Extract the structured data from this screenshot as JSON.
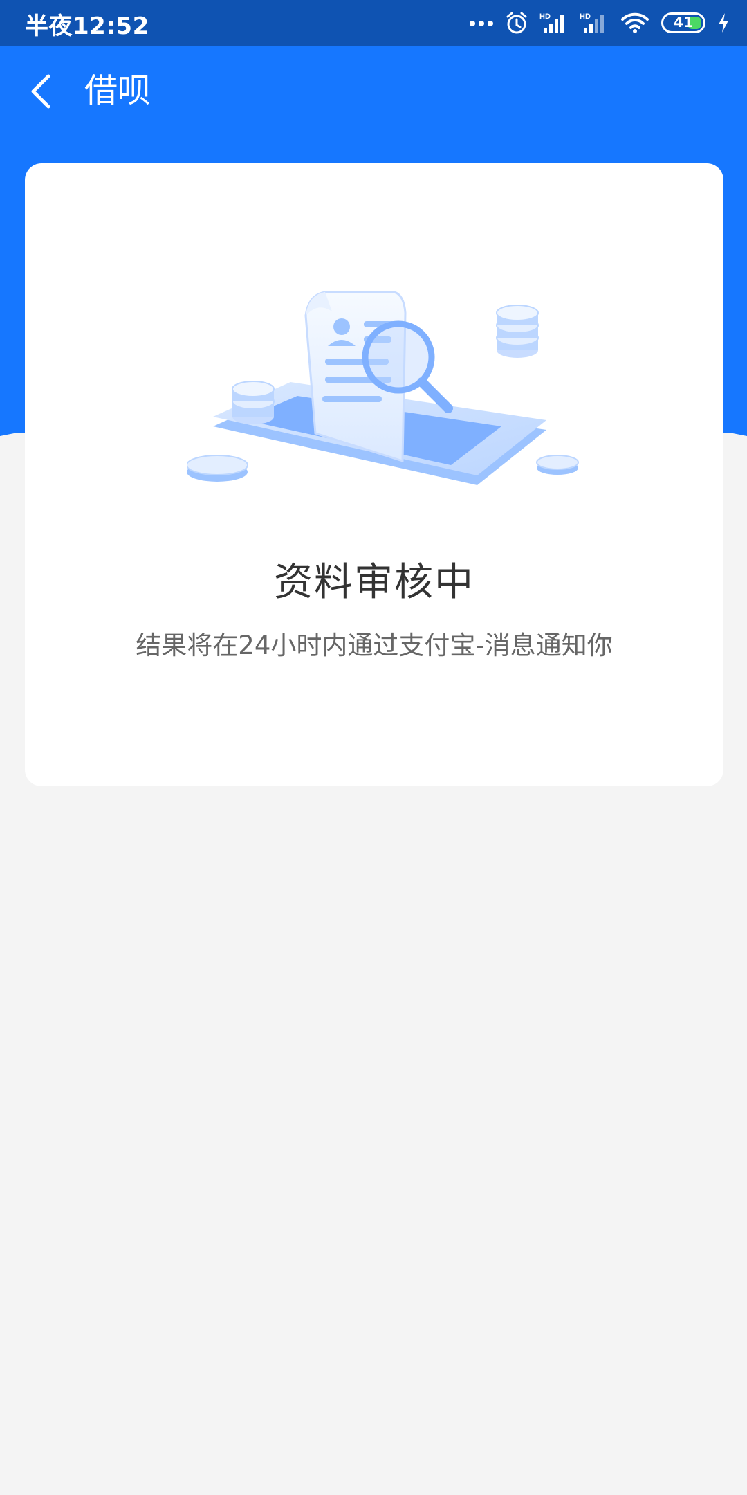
{
  "status_bar": {
    "time": "半夜12:52",
    "battery": "41",
    "icons": [
      "more-dots-icon",
      "alarm-icon",
      "signal-hd-icon",
      "signal-hd-icon",
      "wifi-icon",
      "battery-icon",
      "charging-icon"
    ]
  },
  "header": {
    "title": "借呗",
    "back_icon": "chevron-left-icon",
    "background_color": "#1677ff"
  },
  "card": {
    "illustration_icon": "document-review-illustration",
    "title": "资料审核中",
    "subtitle": "结果将在24小时内通过支付宝-消息通知你"
  },
  "colors": {
    "status_bar": "#0f53b2",
    "accent": "#1677ff",
    "page_background": "#f4f4f4"
  }
}
